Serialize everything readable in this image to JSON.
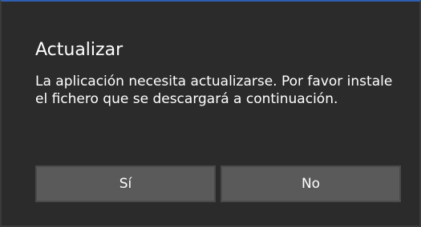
{
  "dialog": {
    "title": "Actualizar",
    "message": "La aplicación necesita actualizarse. Por favor instale el fichero que se descargará a continuación.",
    "buttons": {
      "yes_label": "Sí",
      "no_label": "No"
    }
  },
  "colors": {
    "background": "#2b2b2b",
    "accent_border": "#2f5fb3",
    "button_background": "#5a5a5a",
    "text": "#ffffff"
  }
}
